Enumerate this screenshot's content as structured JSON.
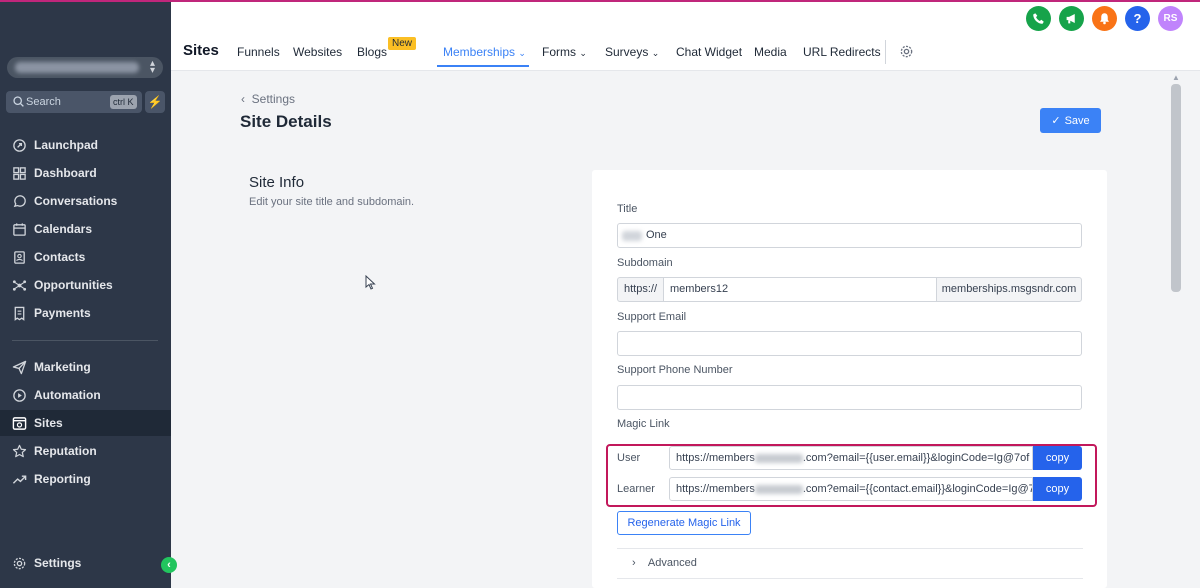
{
  "sidebar": {
    "search_placeholder": "Search",
    "search_shortcut": "ctrl K",
    "items": [
      {
        "label": "Launchpad",
        "icon": "rocket-icon"
      },
      {
        "label": "Dashboard",
        "icon": "grid-icon"
      },
      {
        "label": "Conversations",
        "icon": "chat-icon"
      },
      {
        "label": "Calendars",
        "icon": "calendar-icon"
      },
      {
        "label": "Contacts",
        "icon": "contact-card-icon"
      },
      {
        "label": "Opportunities",
        "icon": "network-icon"
      },
      {
        "label": "Payments",
        "icon": "receipt-icon"
      },
      {
        "label": "Marketing",
        "icon": "send-icon"
      },
      {
        "label": "Automation",
        "icon": "automation-icon"
      },
      {
        "label": "Sites",
        "icon": "globe-window-icon",
        "active": true
      },
      {
        "label": "Reputation",
        "icon": "star-icon"
      },
      {
        "label": "Reporting",
        "icon": "trend-icon"
      }
    ],
    "settings_label": "Settings"
  },
  "header": {
    "section_title": "Sites",
    "tabs": {
      "funnels": "Funnels",
      "websites": "Websites",
      "blogs": "Blogs",
      "blogs_badge": "New",
      "memberships": "Memberships",
      "forms": "Forms",
      "surveys": "Surveys",
      "chat_widget": "Chat Widget",
      "media": "Media",
      "url_redirects": "URL Redirects"
    },
    "avatar_initials": "RS",
    "colors": {
      "phone": "#16a34a",
      "megaphone": "#16a34a",
      "bell": "#f97316",
      "help": "#2563eb",
      "avatar": "#c084fc",
      "accent": "#3b82f6"
    }
  },
  "page": {
    "back_label": "Settings",
    "title": "Site Details",
    "save_label": "Save",
    "section_title": "Site Info",
    "section_subtitle": "Edit your site title and subdomain."
  },
  "form": {
    "title_label": "Title",
    "title_value": "One",
    "subdomain_label": "Subdomain",
    "subdomain_prefix": "https://",
    "subdomain_value": "members12",
    "subdomain_suffix": "memberships.msgsndr.com",
    "support_email_label": "Support Email",
    "support_phone_label": "Support Phone Number",
    "magic_link_label": "Magic Link",
    "user_label": "User",
    "user_link_start": "https://members",
    "user_link_end": ".com?email={{user.email}}&loginCode=Ig@7of",
    "learner_label": "Learner",
    "learner_link_start": "https://members",
    "learner_link_end": ".com?email={{contact.email}}&loginCode=Ig@7",
    "copy_label": "copy",
    "regenerate_label": "Regenerate Magic Link",
    "advanced_label": "Advanced"
  }
}
